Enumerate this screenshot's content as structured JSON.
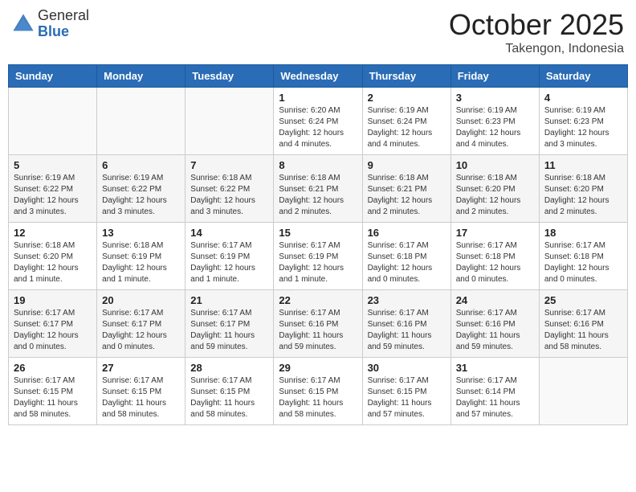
{
  "header": {
    "logo_general": "General",
    "logo_blue": "Blue",
    "month": "October 2025",
    "location": "Takengon, Indonesia"
  },
  "days_of_week": [
    "Sunday",
    "Monday",
    "Tuesday",
    "Wednesday",
    "Thursday",
    "Friday",
    "Saturday"
  ],
  "weeks": [
    [
      {
        "day": "",
        "info": ""
      },
      {
        "day": "",
        "info": ""
      },
      {
        "day": "",
        "info": ""
      },
      {
        "day": "1",
        "info": "Sunrise: 6:20 AM\nSunset: 6:24 PM\nDaylight: 12 hours\nand 4 minutes."
      },
      {
        "day": "2",
        "info": "Sunrise: 6:19 AM\nSunset: 6:24 PM\nDaylight: 12 hours\nand 4 minutes."
      },
      {
        "day": "3",
        "info": "Sunrise: 6:19 AM\nSunset: 6:23 PM\nDaylight: 12 hours\nand 4 minutes."
      },
      {
        "day": "4",
        "info": "Sunrise: 6:19 AM\nSunset: 6:23 PM\nDaylight: 12 hours\nand 3 minutes."
      }
    ],
    [
      {
        "day": "5",
        "info": "Sunrise: 6:19 AM\nSunset: 6:22 PM\nDaylight: 12 hours\nand 3 minutes."
      },
      {
        "day": "6",
        "info": "Sunrise: 6:19 AM\nSunset: 6:22 PM\nDaylight: 12 hours\nand 3 minutes."
      },
      {
        "day": "7",
        "info": "Sunrise: 6:18 AM\nSunset: 6:22 PM\nDaylight: 12 hours\nand 3 minutes."
      },
      {
        "day": "8",
        "info": "Sunrise: 6:18 AM\nSunset: 6:21 PM\nDaylight: 12 hours\nand 2 minutes."
      },
      {
        "day": "9",
        "info": "Sunrise: 6:18 AM\nSunset: 6:21 PM\nDaylight: 12 hours\nand 2 minutes."
      },
      {
        "day": "10",
        "info": "Sunrise: 6:18 AM\nSunset: 6:20 PM\nDaylight: 12 hours\nand 2 minutes."
      },
      {
        "day": "11",
        "info": "Sunrise: 6:18 AM\nSunset: 6:20 PM\nDaylight: 12 hours\nand 2 minutes."
      }
    ],
    [
      {
        "day": "12",
        "info": "Sunrise: 6:18 AM\nSunset: 6:20 PM\nDaylight: 12 hours\nand 1 minute."
      },
      {
        "day": "13",
        "info": "Sunrise: 6:18 AM\nSunset: 6:19 PM\nDaylight: 12 hours\nand 1 minute."
      },
      {
        "day": "14",
        "info": "Sunrise: 6:17 AM\nSunset: 6:19 PM\nDaylight: 12 hours\nand 1 minute."
      },
      {
        "day": "15",
        "info": "Sunrise: 6:17 AM\nSunset: 6:19 PM\nDaylight: 12 hours\nand 1 minute."
      },
      {
        "day": "16",
        "info": "Sunrise: 6:17 AM\nSunset: 6:18 PM\nDaylight: 12 hours\nand 0 minutes."
      },
      {
        "day": "17",
        "info": "Sunrise: 6:17 AM\nSunset: 6:18 PM\nDaylight: 12 hours\nand 0 minutes."
      },
      {
        "day": "18",
        "info": "Sunrise: 6:17 AM\nSunset: 6:18 PM\nDaylight: 12 hours\nand 0 minutes."
      }
    ],
    [
      {
        "day": "19",
        "info": "Sunrise: 6:17 AM\nSunset: 6:17 PM\nDaylight: 12 hours\nand 0 minutes."
      },
      {
        "day": "20",
        "info": "Sunrise: 6:17 AM\nSunset: 6:17 PM\nDaylight: 12 hours\nand 0 minutes."
      },
      {
        "day": "21",
        "info": "Sunrise: 6:17 AM\nSunset: 6:17 PM\nDaylight: 11 hours\nand 59 minutes."
      },
      {
        "day": "22",
        "info": "Sunrise: 6:17 AM\nSunset: 6:16 PM\nDaylight: 11 hours\nand 59 minutes."
      },
      {
        "day": "23",
        "info": "Sunrise: 6:17 AM\nSunset: 6:16 PM\nDaylight: 11 hours\nand 59 minutes."
      },
      {
        "day": "24",
        "info": "Sunrise: 6:17 AM\nSunset: 6:16 PM\nDaylight: 11 hours\nand 59 minutes."
      },
      {
        "day": "25",
        "info": "Sunrise: 6:17 AM\nSunset: 6:16 PM\nDaylight: 11 hours\nand 58 minutes."
      }
    ],
    [
      {
        "day": "26",
        "info": "Sunrise: 6:17 AM\nSunset: 6:15 PM\nDaylight: 11 hours\nand 58 minutes."
      },
      {
        "day": "27",
        "info": "Sunrise: 6:17 AM\nSunset: 6:15 PM\nDaylight: 11 hours\nand 58 minutes."
      },
      {
        "day": "28",
        "info": "Sunrise: 6:17 AM\nSunset: 6:15 PM\nDaylight: 11 hours\nand 58 minutes."
      },
      {
        "day": "29",
        "info": "Sunrise: 6:17 AM\nSunset: 6:15 PM\nDaylight: 11 hours\nand 58 minutes."
      },
      {
        "day": "30",
        "info": "Sunrise: 6:17 AM\nSunset: 6:15 PM\nDaylight: 11 hours\nand 57 minutes."
      },
      {
        "day": "31",
        "info": "Sunrise: 6:17 AM\nSunset: 6:14 PM\nDaylight: 11 hours\nand 57 minutes."
      },
      {
        "day": "",
        "info": ""
      }
    ]
  ]
}
